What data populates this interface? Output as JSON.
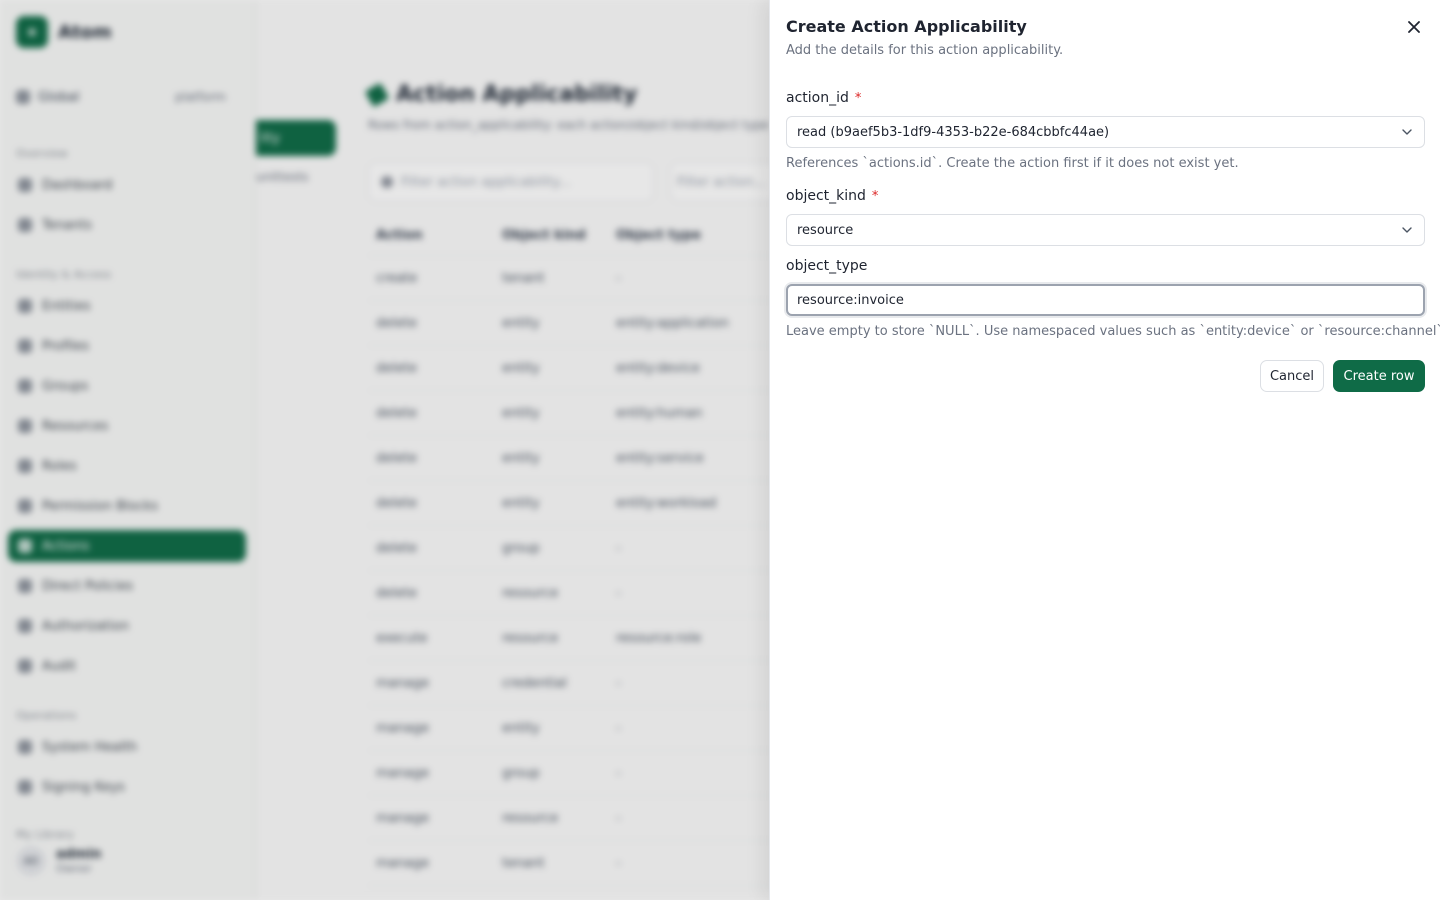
{
  "app": {
    "brand": "Atom",
    "scope_label": "Global",
    "scope_value": "platform"
  },
  "sidebar": {
    "sections": [
      {
        "title": "Overview",
        "items": [
          "Dashboard",
          "Tenants"
        ]
      },
      {
        "title": "Identity & Access",
        "items": [
          "Entities",
          "Profiles",
          "Groups",
          "Resources",
          "Roles",
          "Permission Blocks",
          "Actions",
          "Direct Policies",
          "Authorization",
          "Audit"
        ]
      },
      {
        "title": "Operations",
        "items": [
          "System Health",
          "Signing Keys"
        ]
      },
      {
        "title": "My Library",
        "items": []
      }
    ],
    "active_item": "Actions",
    "user": {
      "initials": "AD",
      "name": "admin",
      "role": "Owner"
    }
  },
  "main": {
    "tab_button": "lity",
    "tab_sub": "unittests",
    "title": "Action Applicability",
    "description": "Rows from action_applicability: each action/object kind/object type",
    "filter_placeholder": "Filter action applicability...",
    "filter_action_placeholder": "Filter action...",
    "columns": [
      "Action",
      "Object kind",
      "Object type"
    ],
    "rows": [
      [
        "create",
        "tenant",
        "-"
      ],
      [
        "delete",
        "entity",
        "entity:application"
      ],
      [
        "delete",
        "entity",
        "entity:device"
      ],
      [
        "delete",
        "entity",
        "entity:human"
      ],
      [
        "delete",
        "entity",
        "entity:service"
      ],
      [
        "delete",
        "entity",
        "entity:workload"
      ],
      [
        "delete",
        "group",
        "-"
      ],
      [
        "delete",
        "resource",
        "-"
      ],
      [
        "execute",
        "resource",
        "resource:role"
      ],
      [
        "manage",
        "credential",
        "-"
      ],
      [
        "manage",
        "entity",
        "-"
      ],
      [
        "manage",
        "group",
        "-"
      ],
      [
        "manage",
        "resource",
        "-"
      ],
      [
        "manage",
        "tenant",
        "-"
      ]
    ]
  },
  "sheet": {
    "title": "Create Action Applicability",
    "description": "Add the details for this action applicability.",
    "required_mark": "*",
    "action_id": {
      "label": "action_id",
      "value": "read (b9aef5b3-1df9-4353-b22e-684cbbfc44ae)",
      "helper": "References `actions.id`. Create the action first if it does not exist yet."
    },
    "object_kind": {
      "label": "object_kind",
      "value": "resource"
    },
    "object_type": {
      "label": "object_type",
      "value": "resource:invoice",
      "helper": "Leave empty to store `NULL`. Use namespaced values such as `entity:device` or `resource:channel`."
    },
    "cancel_label": "Cancel",
    "submit_label": "Create row"
  },
  "colors": {
    "brand": "#0f6b47",
    "required": "#dc2626",
    "muted_text": "#6b7280"
  }
}
